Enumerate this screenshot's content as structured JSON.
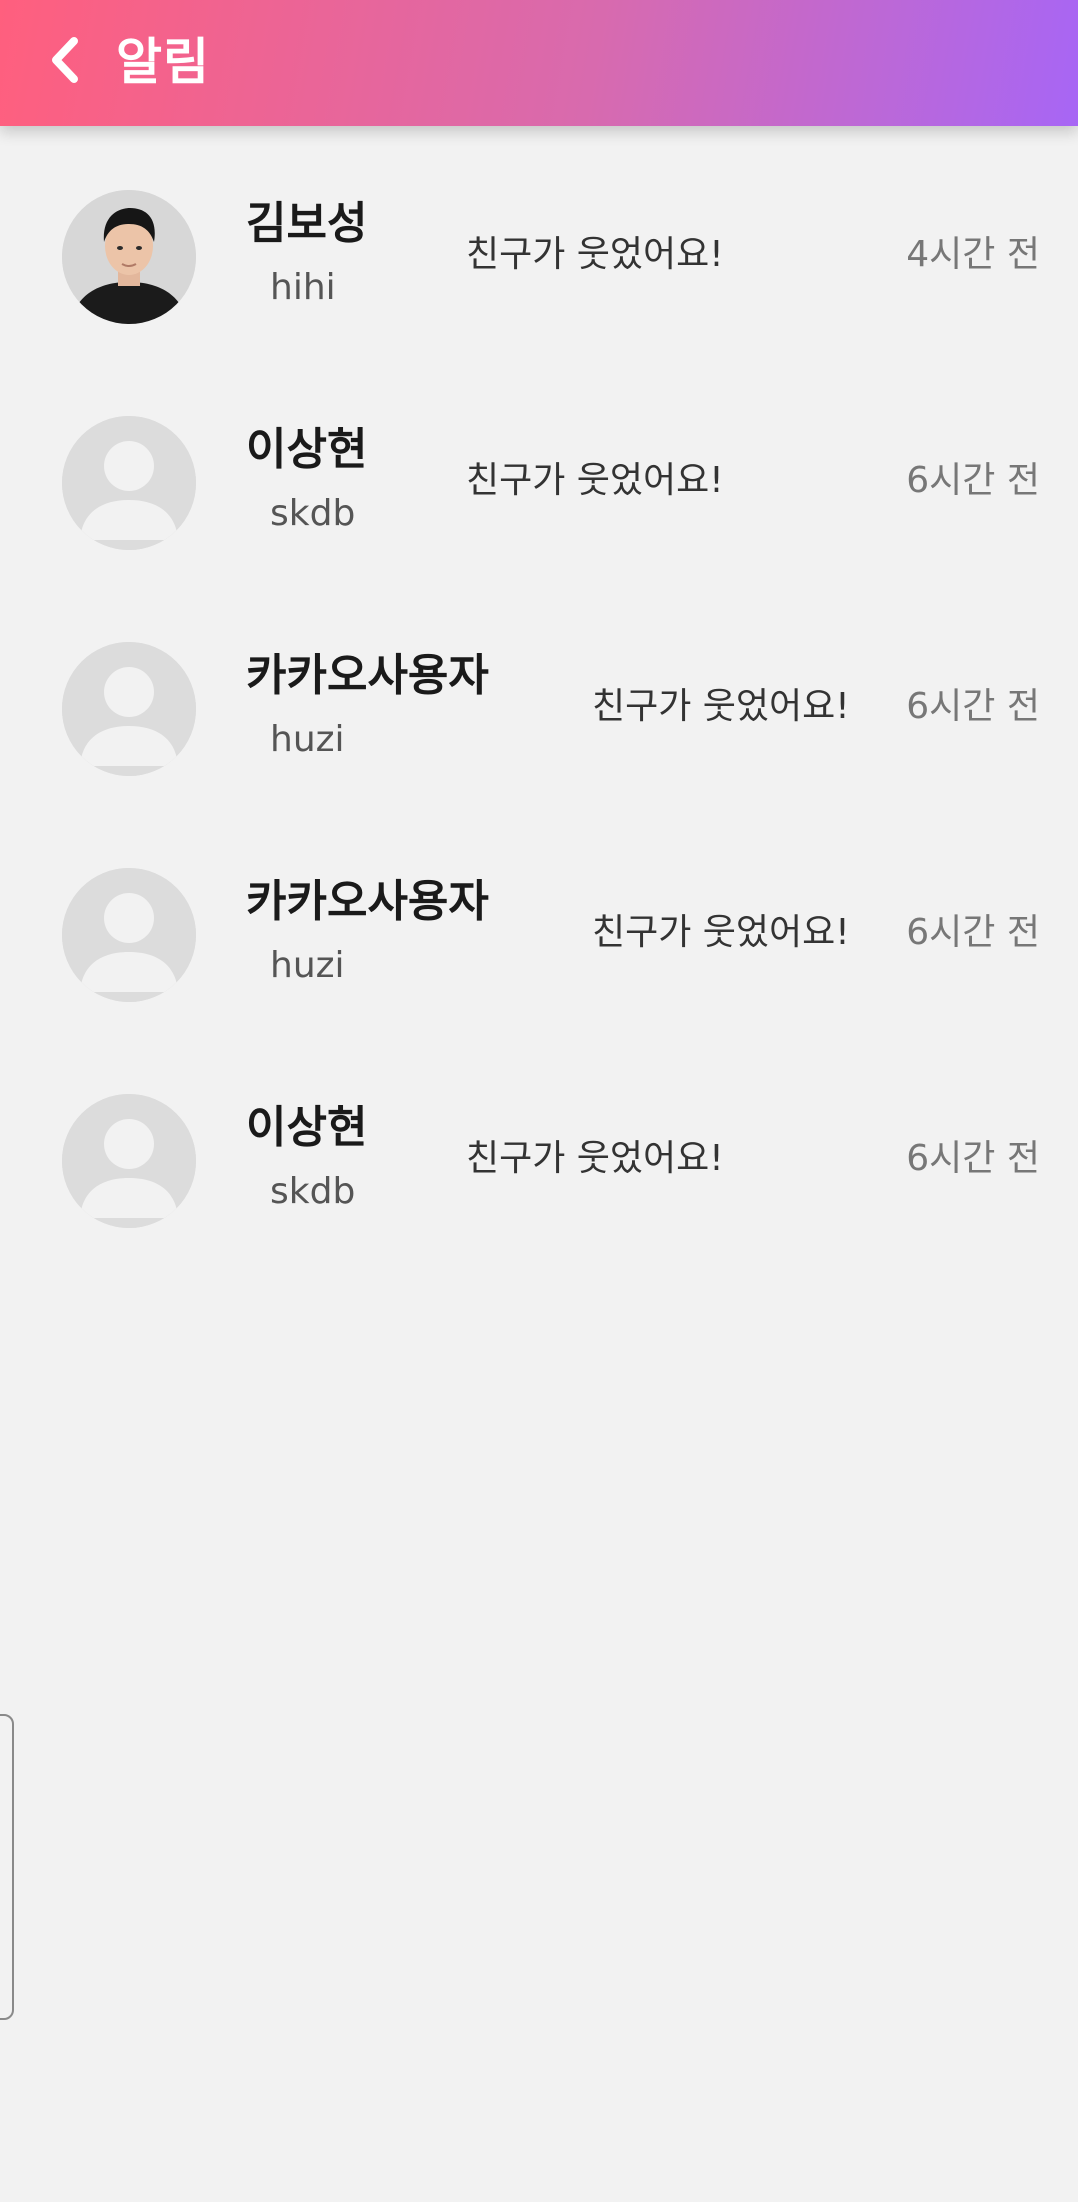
{
  "header": {
    "title": "알림",
    "back_icon": "chevron-left-icon",
    "gradient_start": "#ff5f7e",
    "gradient_end": "#a766f5"
  },
  "notifications": [
    {
      "name": "김보성",
      "user_id": "hihi",
      "message": "친구가 웃었어요!",
      "time": "4시간 전",
      "avatar": "profile-photo"
    },
    {
      "name": "이상현",
      "user_id": "skdb",
      "message": "친구가 웃었어요!",
      "time": "6시간 전",
      "avatar": "default-avatar-icon"
    },
    {
      "name": "카카오사용자",
      "user_id": "huzi",
      "message": "친구가 웃었어요!",
      "time": "6시간 전",
      "avatar": "default-avatar-icon"
    },
    {
      "name": "카카오사용자",
      "user_id": "huzi",
      "message": "친구가 웃었어요!",
      "time": "6시간 전",
      "avatar": "default-avatar-icon"
    },
    {
      "name": "이상현",
      "user_id": "skdb",
      "message": "친구가 웃었어요!",
      "time": "6시간 전",
      "avatar": "default-avatar-icon"
    }
  ]
}
